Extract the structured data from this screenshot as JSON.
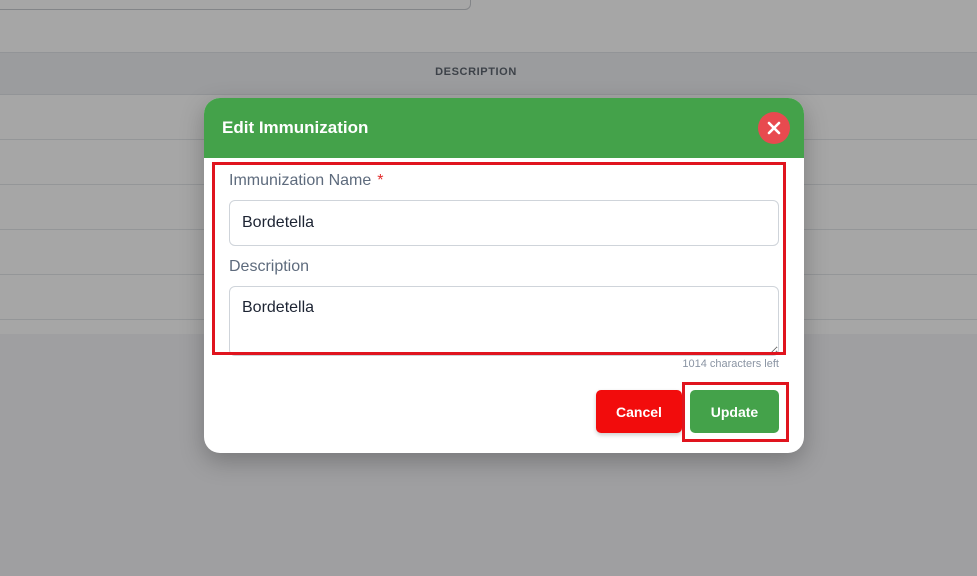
{
  "background": {
    "table_header": "DESCRIPTION"
  },
  "modal": {
    "title": "Edit Immunization",
    "name_label": "Immunization Name",
    "required_marker": "*",
    "name_value": "Bordetella",
    "description_label": "Description",
    "description_value": "Bordetella",
    "chars_left": "1014 characters left",
    "cancel_label": "Cancel",
    "update_label": "Update"
  },
  "colors": {
    "header": "#44a24a",
    "close_button": "#e84a4f",
    "cancel_button": "#f20c0c",
    "update_button": "#44a24a",
    "highlight": "#e0141e"
  },
  "icons": {
    "close": "close-icon"
  }
}
